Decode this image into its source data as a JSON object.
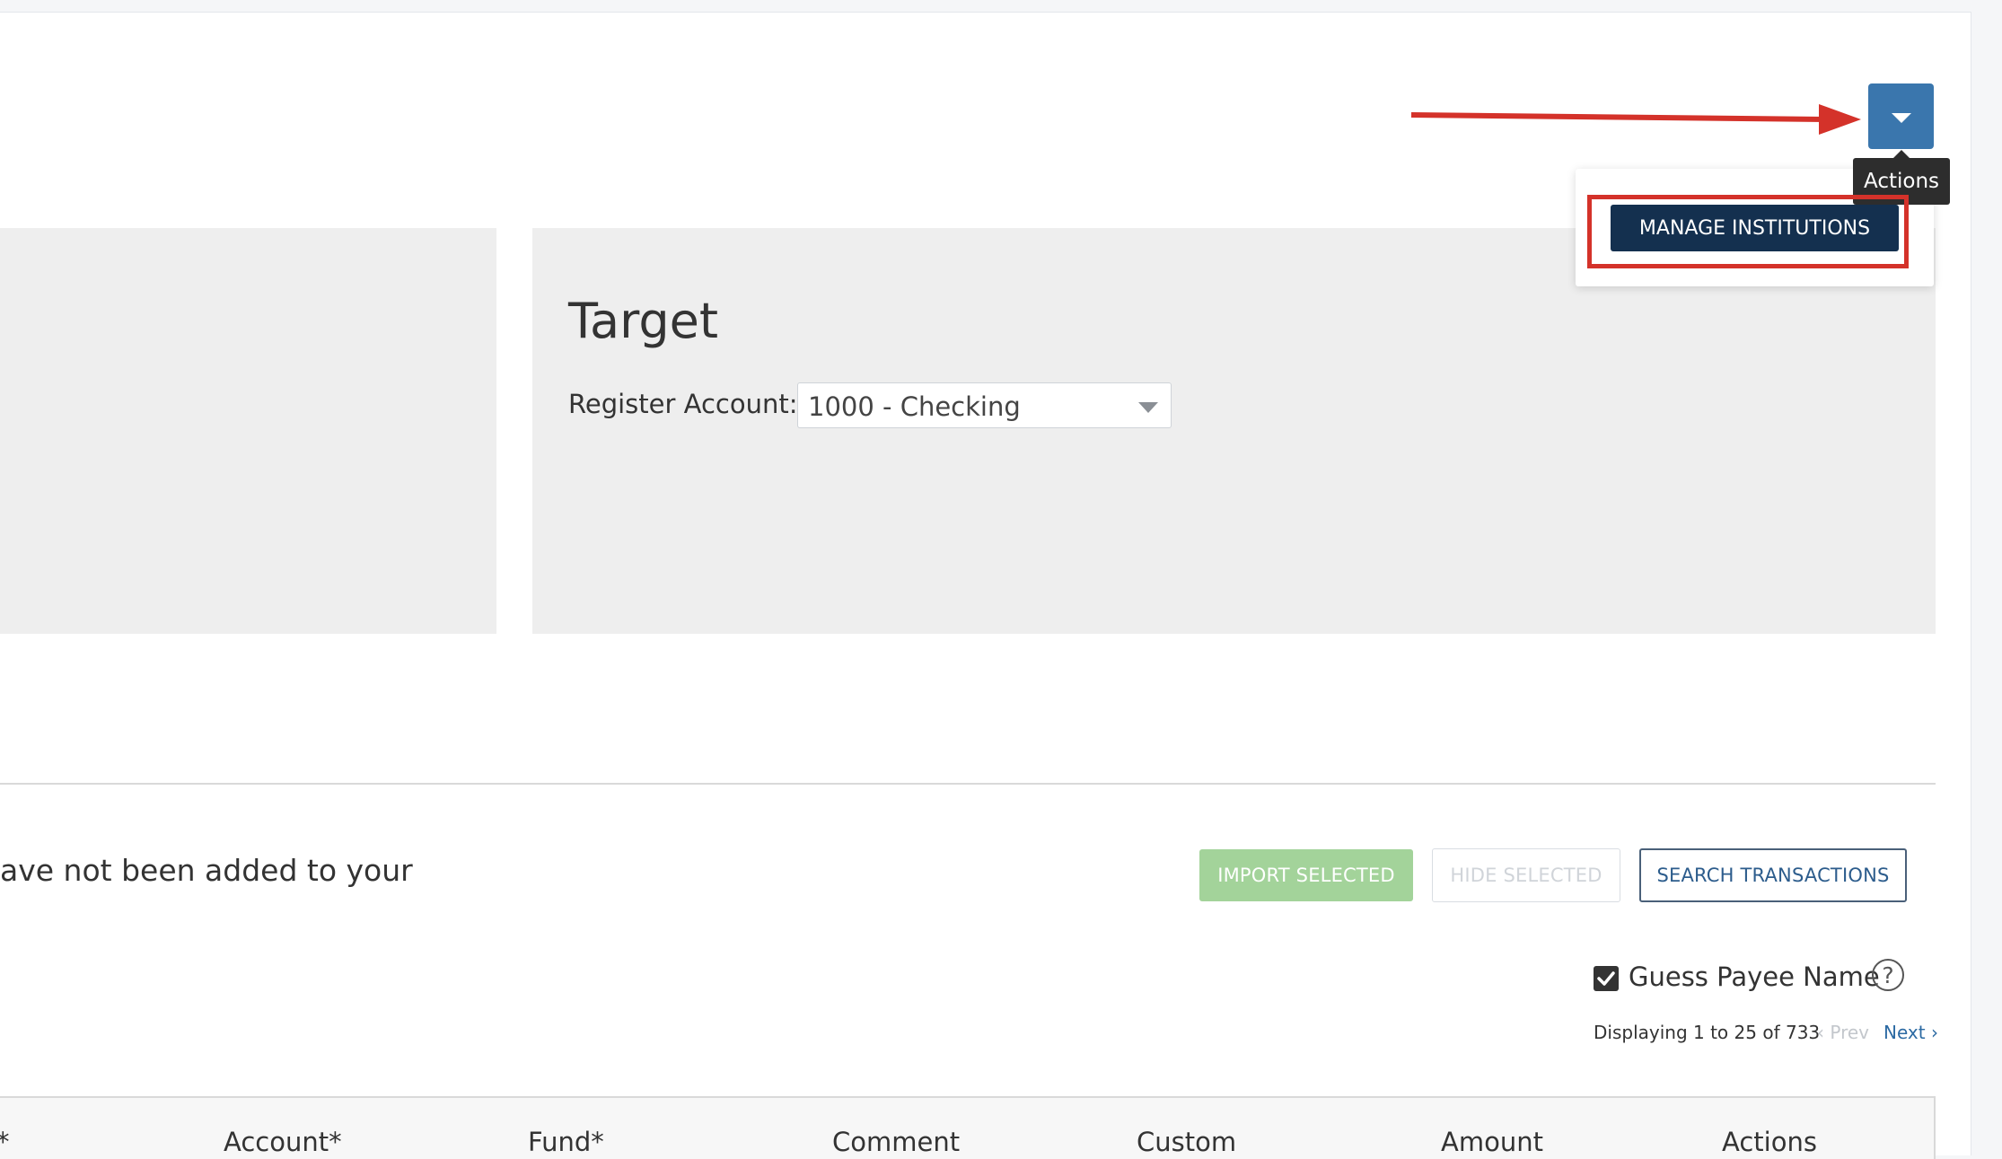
{
  "header": {
    "actions_tooltip": "Actions",
    "actions_menu": {
      "items": [
        {
          "label": "MANAGE INSTITUTIONS"
        }
      ]
    }
  },
  "target": {
    "title": "Target",
    "register_account_label": "Register Account:",
    "register_account_value": "1000 - Checking"
  },
  "transactions": {
    "intro_text": "ave not been added to your",
    "import_selected_label": "IMPORT SELECTED",
    "hide_selected_label": "HIDE SELECTED",
    "search_transactions_label": "SEARCH TRANSACTIONS",
    "guess_payee_label": "Guess Payee Name",
    "guess_payee_checked": true,
    "help_icon_glyph": "?",
    "displaying_text": "Displaying 1 to 25 of 733",
    "prev_label": "‹ Prev",
    "next_label": "Next ›",
    "columns": [
      "*",
      "Account*",
      "Fund*",
      "Comment",
      "Custom",
      "Amount",
      "Actions"
    ]
  },
  "colors": {
    "actions_button": "#3a76ad",
    "manage_button": "#14304f",
    "import_button": "#a3d39a",
    "annotation_red": "#d4322a"
  },
  "icons": [
    "chevron-down-icon",
    "checkmark-icon",
    "help-icon",
    "arrow-annotation-icon"
  ]
}
